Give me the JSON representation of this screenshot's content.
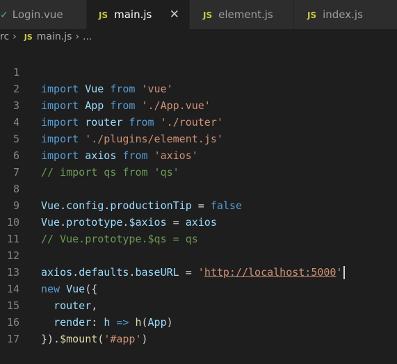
{
  "tabs": [
    {
      "icon": "vue-icon",
      "label": "Login.vue",
      "active": false
    },
    {
      "icon": "js-icon",
      "label": "main.js",
      "active": true
    },
    {
      "icon": "js-icon",
      "label": "element.js",
      "active": false
    },
    {
      "icon": "js-icon",
      "label": "index.js",
      "active": false
    }
  ],
  "tab_icons": {
    "js": "JS",
    "vue": "✓",
    "close": "✕"
  },
  "breadcrumb": {
    "folder": "rc",
    "file": "main.js",
    "more": "..."
  },
  "line_numbers": [
    "1",
    "2",
    "3",
    "4",
    "5",
    "6",
    "7",
    "8",
    "9",
    "10",
    "11",
    "12",
    "13",
    "14",
    "15",
    "16",
    "17"
  ],
  "code": {
    "l1": {
      "kw": "import",
      "id": "Vue",
      "from": "from",
      "str": "'vue'"
    },
    "l2": {
      "kw": "import",
      "id": "App",
      "from": "from",
      "str": "'./App.vue'"
    },
    "l3": {
      "kw": "import",
      "id": "router",
      "from": "from",
      "str": "'./router'"
    },
    "l4": {
      "kw": "import",
      "str": "'./plugins/element.js'"
    },
    "l5": {
      "kw": "import",
      "id": "axios",
      "from": "from",
      "str": "'axios'"
    },
    "l6": {
      "comment": "// import qs from 'qs'"
    },
    "l8": {
      "obj": "Vue",
      "d1": ".",
      "p1": "config",
      "d2": ".",
      "p2": "productionTip",
      "eq": " = ",
      "val": "false"
    },
    "l9": {
      "obj": "Vue",
      "d1": ".",
      "p1": "prototype",
      "d2": ".",
      "p2": "$axios",
      "eq": " = ",
      "val": "axios"
    },
    "l10": {
      "comment": "// Vue.prototype.$qs = qs"
    },
    "l12": {
      "obj": "axios",
      "d1": ".",
      "p1": "defaults",
      "d2": ".",
      "p2": "baseURL",
      "eq": " = ",
      "q1": "'",
      "url": "http://localhost:5000",
      "q2": "'"
    },
    "l13": {
      "kw": "new",
      "fn": "Vue",
      "rest": "({"
    },
    "l14": {
      "id": "router",
      "rest": ","
    },
    "l15": {
      "key": "render",
      "colon": ": ",
      "param": "h",
      "arrow": " => ",
      "fn": "h",
      "open": "(",
      "arg": "App",
      "close": ")"
    },
    "l16": {
      "open": "}).",
      "fn": "$mount",
      "p_open": "(",
      "str": "'#app'",
      "p_close": ")"
    }
  },
  "colors": {
    "keyword": "#569cd6",
    "variable": "#9cdcfe",
    "string": "#ce9178",
    "function": "#dcdcaa",
    "comment": "#6a9955",
    "js_icon": "#cbcb41",
    "vue_icon": "#41b883"
  }
}
